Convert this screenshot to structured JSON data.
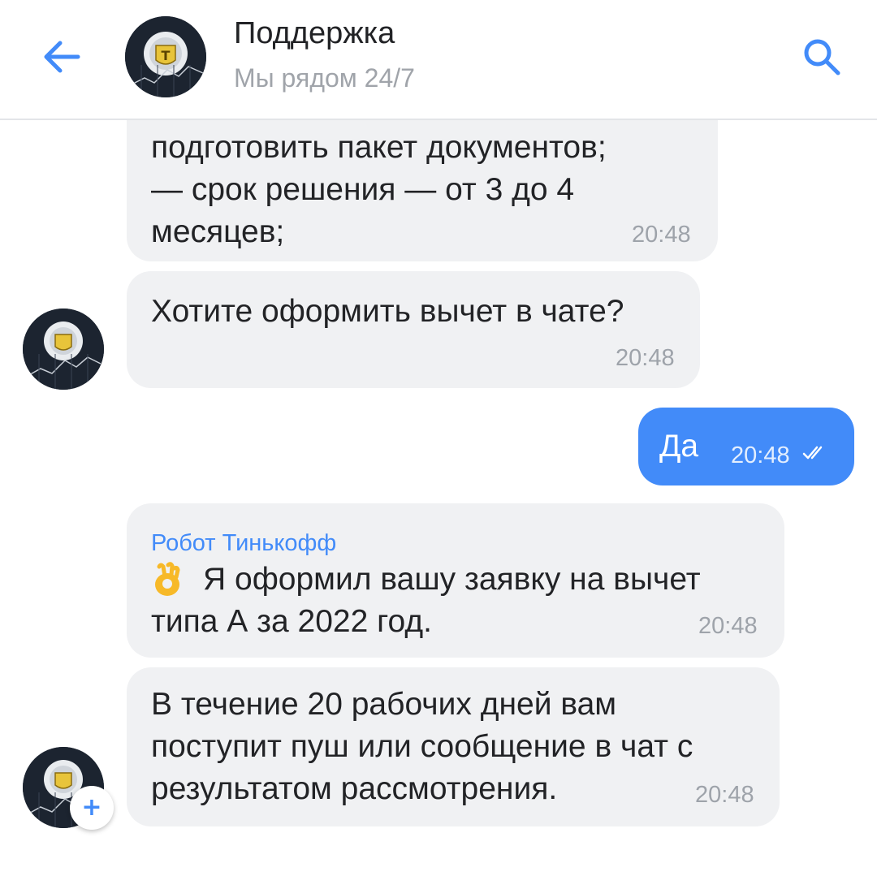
{
  "header": {
    "title": "Поддержка",
    "subtitle": "Мы рядом 24/7"
  },
  "messages": [
    {
      "direction": "in",
      "lines": [
        "подготовить пакет документов;",
        "— срок решения — от 3 до 4",
        "месяцев;"
      ],
      "time": "20:48"
    },
    {
      "direction": "in",
      "lines": [
        "Хотите оформить вычет в чате?"
      ],
      "time": "20:48"
    },
    {
      "direction": "out",
      "lines": [
        "Да"
      ],
      "time": "20:48",
      "status": "read"
    },
    {
      "direction": "in",
      "sender": "Робот Тинькофф",
      "emoji": "ok-hand-emoji",
      "lines": [
        "Я оформил вашу заявку на вычет",
        "типа А за 2022 год."
      ],
      "time": "20:48"
    },
    {
      "direction": "in",
      "lines": [
        "В течение 20 рабочих дней вам",
        "поступит пуш или сообщение в чат с",
        "результатом рассмотрения."
      ],
      "time": "20:48"
    }
  ],
  "icons": {
    "back": "arrow-left-icon",
    "search": "search-icon",
    "add": "plus-icon",
    "read_status": "double-check-icon"
  },
  "colors": {
    "accent": "#428bf9",
    "bubble_in": "#f0f1f3",
    "text": "#222326",
    "muted": "#9ea3aa"
  }
}
